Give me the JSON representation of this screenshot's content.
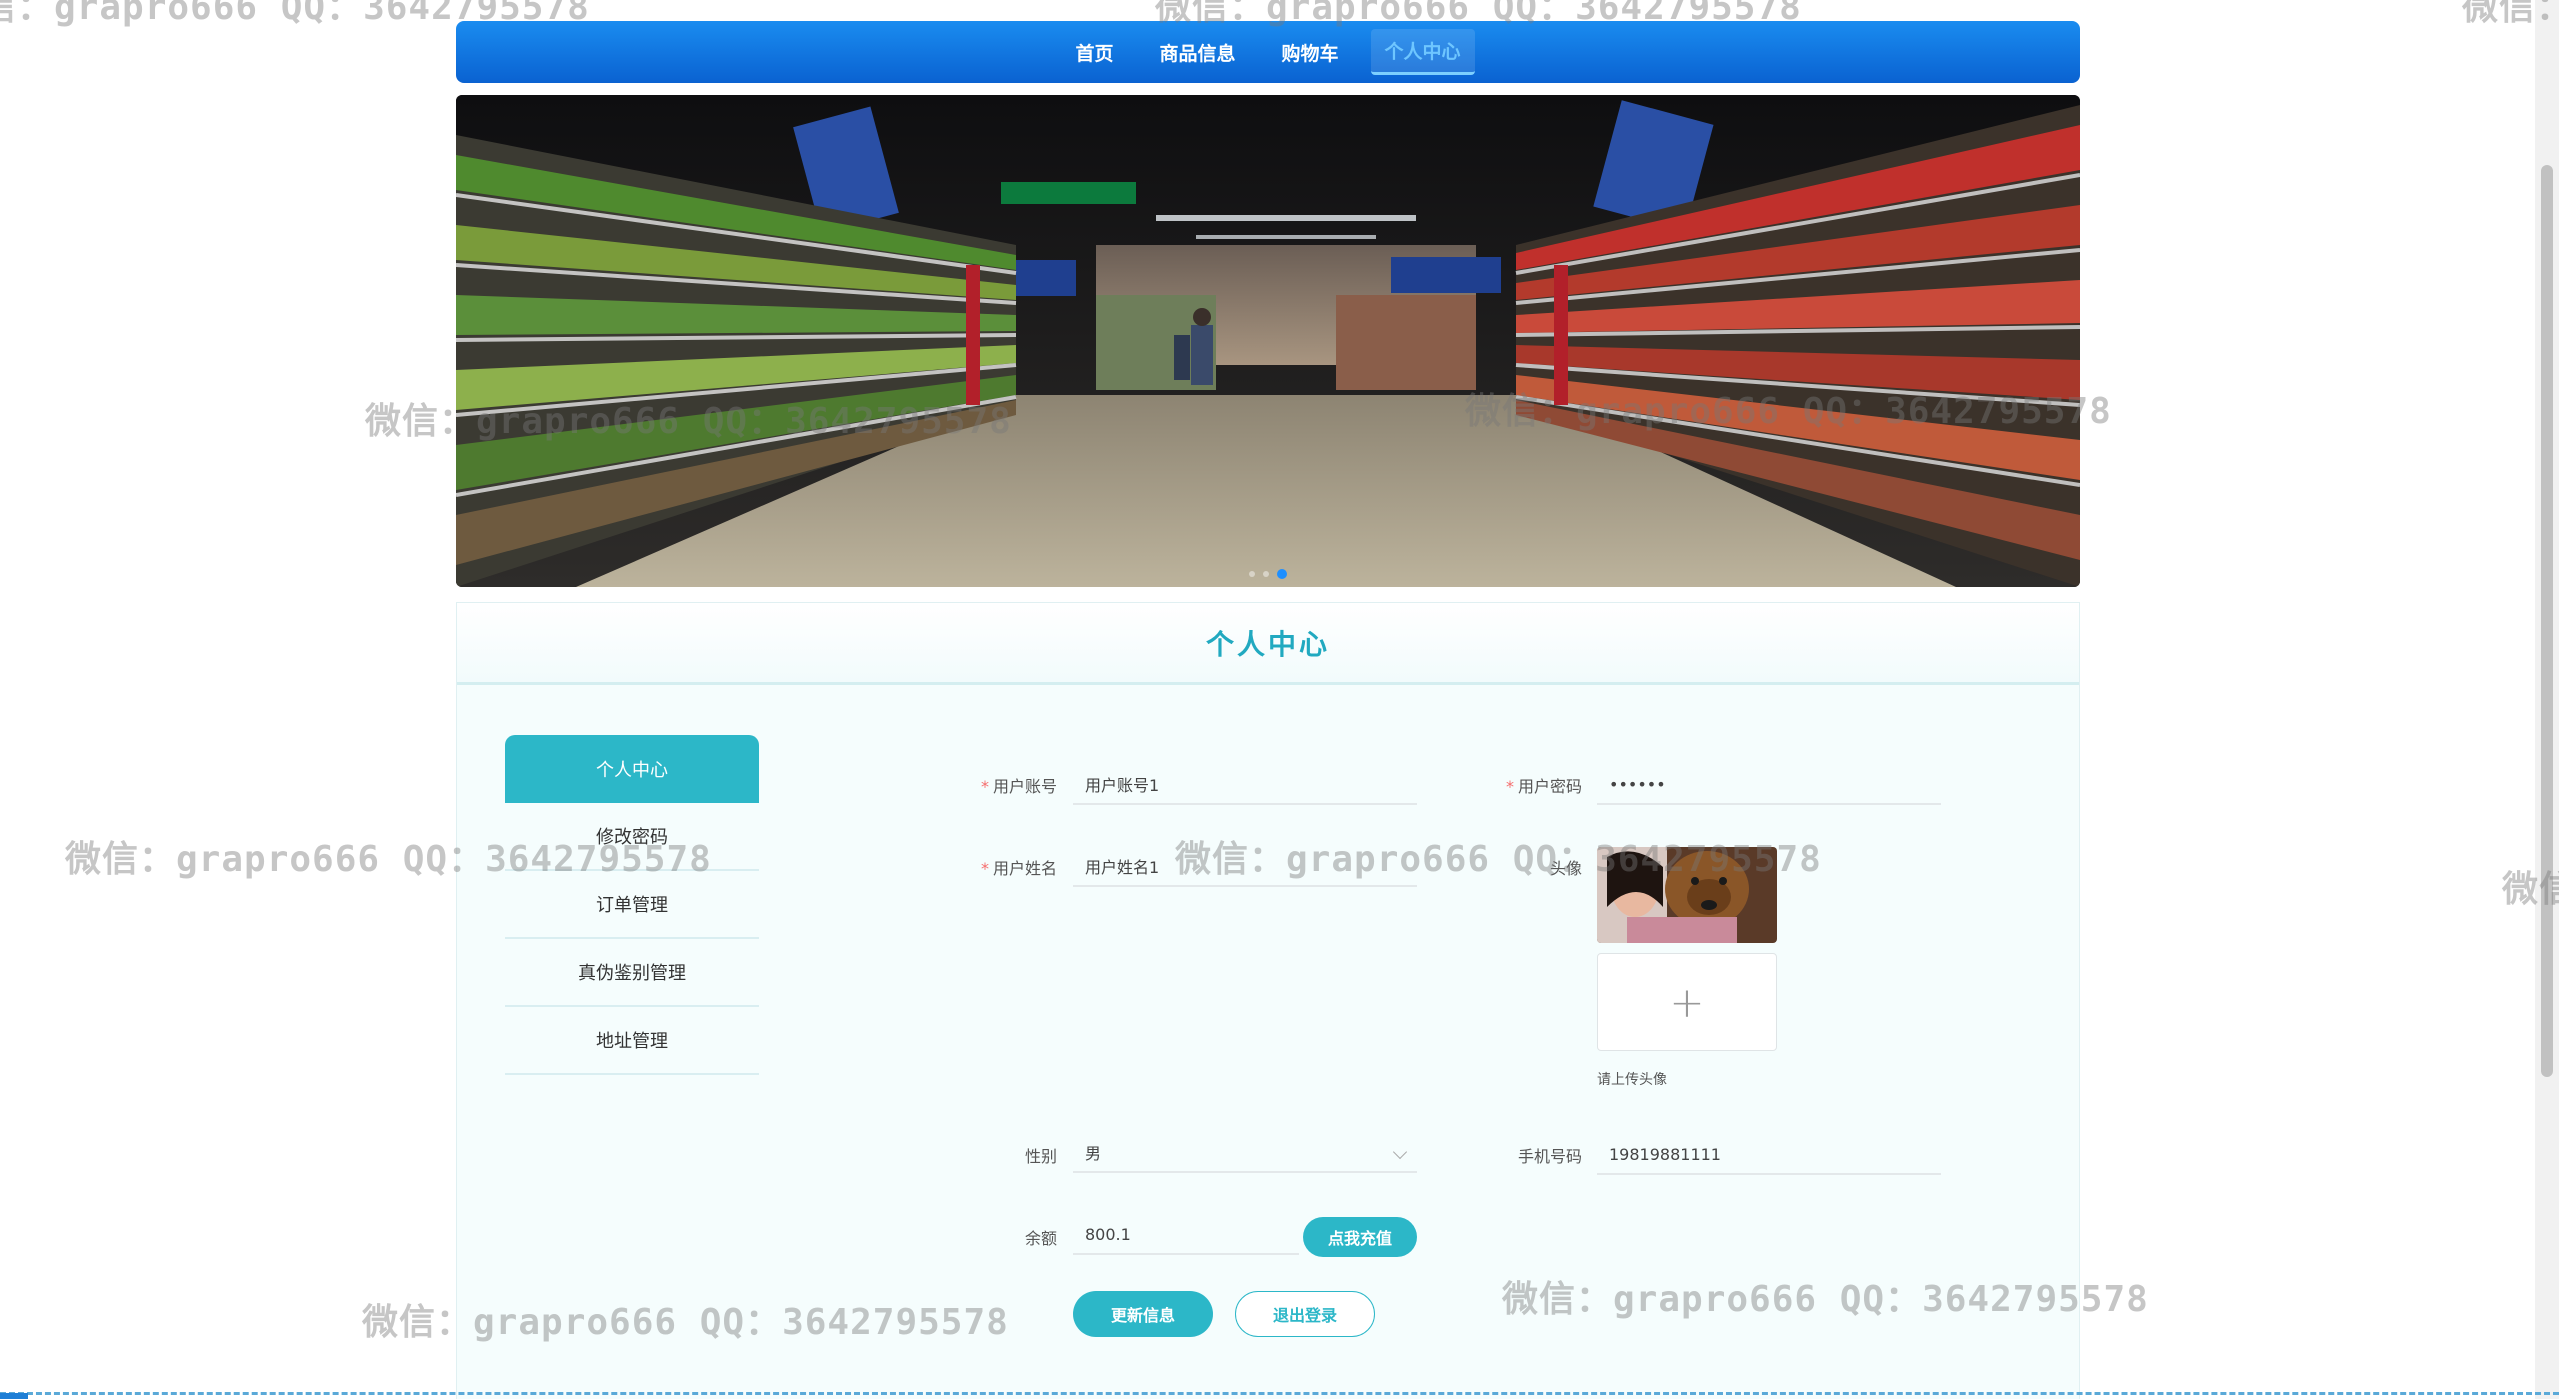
{
  "nav": {
    "items": [
      {
        "label": "首页"
      },
      {
        "label": "商品信息"
      },
      {
        "label": "购物车"
      },
      {
        "label": "个人中心"
      }
    ]
  },
  "banner": {
    "dots": 3,
    "active_dot": 2
  },
  "panel": {
    "title": "个人中心"
  },
  "side_menu": {
    "items": [
      {
        "label": "个人中心"
      },
      {
        "label": "修改密码"
      },
      {
        "label": "订单管理"
      },
      {
        "label": "真伪鉴别管理"
      },
      {
        "label": "地址管理"
      }
    ]
  },
  "form": {
    "account_label": "用户账号",
    "account_value": "用户账号1",
    "password_label": "用户密码",
    "password_value": "••••••",
    "name_label": "用户姓名",
    "name_value": "用户姓名1",
    "avatar_label": "头像",
    "upload_tip": "请上传头像",
    "upload_plus": "+",
    "gender_label": "性别",
    "gender_value": "男",
    "phone_label": "手机号码",
    "phone_value": "19819881111",
    "balance_label": "余额",
    "balance_value": "800.1",
    "recharge_button": "点我充值",
    "update_button": "更新信息",
    "logout_button": "退出登录",
    "required_mark": "*"
  },
  "watermark": {
    "text": "微信：grapro666 QQ：3642795578",
    "fragment_left": "信：grapro666 QQ：3642795578",
    "fragment_right": "微信："
  },
  "colors": {
    "nav_start": "#1a8cf0",
    "nav_end": "#0a62d1",
    "accent": "#2cb7c8",
    "required": "#f56c6c"
  }
}
